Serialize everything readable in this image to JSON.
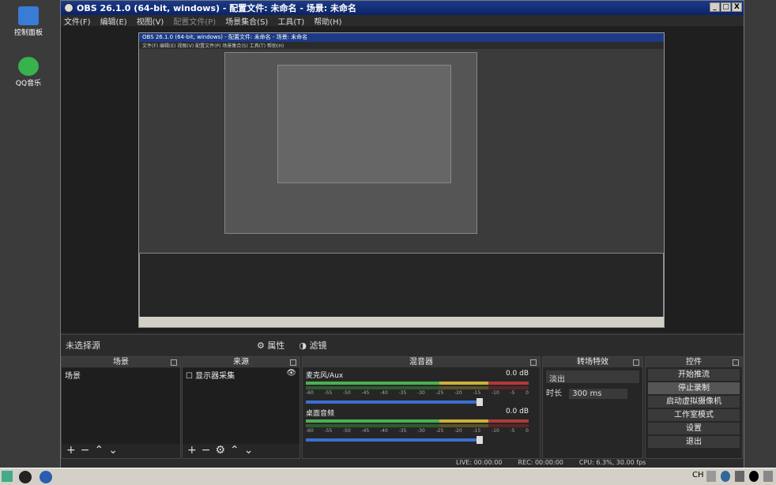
{
  "desktop": {
    "icons": [
      {
        "label": "控制面板"
      },
      {
        "label": "QQ音乐"
      }
    ]
  },
  "window": {
    "title": "OBS 26.1.0 (64-bit, windows) - 配置文件: 未命名 - 场景: 未命名",
    "controls": [
      "_",
      "□",
      "X"
    ]
  },
  "menu": {
    "file": "文件(F)",
    "edit": "编辑(E)",
    "view": "视图(V)",
    "profile": "配置文件(P)",
    "scene_collection": "场景集合(S)",
    "tools": "工具(T)",
    "help": "帮助(H)"
  },
  "inner": {
    "title": "OBS 26.1.0 (64-bit, windows) - 配置文件: 未命名 - 场景: 未命名",
    "menu": "文件(F) 编辑(E) 视图(V) 配置文件(P) 场景集合(S) 工具(T) 帮助(H)"
  },
  "source_bar": {
    "no_source": "未选择源",
    "properties": "属性",
    "filters": "滤镜"
  },
  "docks": {
    "scenes": {
      "title": "场景",
      "items": [
        "场景"
      ]
    },
    "sources": {
      "title": "来源",
      "items": [
        "显示器采集"
      ]
    },
    "mixer": {
      "title": "混音器",
      "channels": [
        {
          "name": "麦克风/Aux",
          "db": "0.0 dB"
        },
        {
          "name": "桌面音频",
          "db": "0.0 dB"
        }
      ],
      "ticks": [
        "-60",
        "-55",
        "-50",
        "-45",
        "-40",
        "-35",
        "-30",
        "-25",
        "-20",
        "-15",
        "-10",
        "-5",
        "0"
      ]
    },
    "transitions": {
      "title": "转场特效",
      "type": "淡出",
      "duration_label": "时长",
      "duration": "300 ms"
    },
    "controls": {
      "title": "控件",
      "buttons": [
        "开始推流",
        "停止录制",
        "启动虚拟摄像机",
        "工作室模式",
        "设置",
        "退出"
      ]
    }
  },
  "status": {
    "live": "LIVE: 00:00:00",
    "rec": "REC: 00:00:00",
    "cpu": "CPU: 6.3%, 30.00 fps"
  },
  "taskbar": {
    "lang": "CH"
  }
}
